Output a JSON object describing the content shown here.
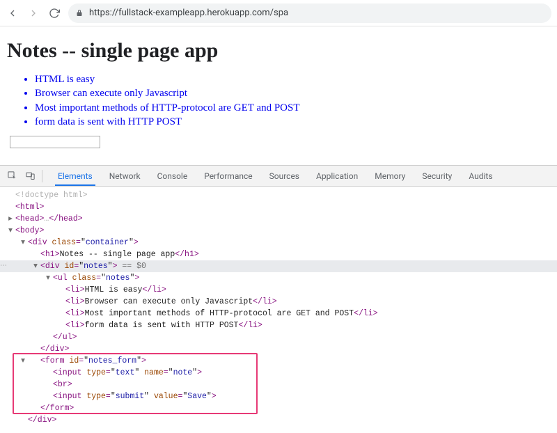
{
  "browser": {
    "url": "https://fullstack-exampleapp.herokuapp.com/spa"
  },
  "page": {
    "title": "Notes -- single page app",
    "notes": [
      "HTML is easy",
      "Browser can execute only Javascript",
      "Most important methods of HTTP-protocol are GET and POST",
      "form data is sent with HTTP POST"
    ],
    "input_value": ""
  },
  "devtools": {
    "tabs": [
      "Elements",
      "Network",
      "Console",
      "Performance",
      "Sources",
      "Application",
      "Memory",
      "Security",
      "Audits"
    ],
    "active_tab": 0,
    "selected_marker": " == $0"
  },
  "dom": {
    "doctype": "<!doctype html>",
    "html_open": "<html>",
    "head": "<head>…</head>",
    "body_open": "<body>",
    "div_container_open_prefix": "<div ",
    "class_label": "class",
    "container_val": "container",
    "h1_open": "<h1>",
    "h1_text": "Notes -- single page app",
    "h1_close": "</h1>",
    "div_notes_open_prefix": "<div ",
    "id_label": "id",
    "notes_val": "notes",
    "ul_open_prefix": "<ul ",
    "ul_class_val": "notes",
    "li_open": "<li>",
    "li_close": "</li>",
    "li_texts": [
      "HTML is easy",
      "Browser can execute only Javascript",
      "Most important methods of HTTP-protocol are GET and POST",
      "form data is sent with HTTP POST"
    ],
    "ul_close": "</ul>",
    "div_close": "</div>",
    "form_open_prefix": "<form ",
    "form_id_val": "notes_form",
    "input1_prefix": "<input ",
    "type_label": "type",
    "type_text_val": "text",
    "name_label": "name",
    "name_note_val": "note",
    "br": "<br>",
    "input2_prefix": "<input ",
    "type_submit_val": "submit",
    "value_label": "value",
    "value_save_val": "Save",
    "form_close": "</form>"
  }
}
